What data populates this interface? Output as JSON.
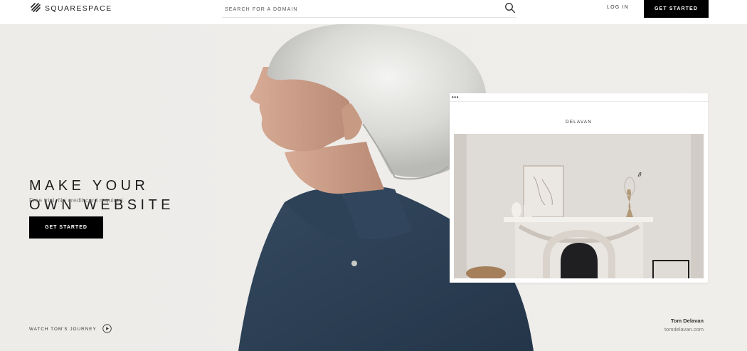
{
  "header": {
    "brand": "SQUARESPACE",
    "search_placeholder": "SEARCH FOR A DOMAIN",
    "login_label": "LOG IN",
    "cta_label": "GET STARTED"
  },
  "hero": {
    "headline_line1": "MAKE YOUR",
    "headline_line2": "OWN WEBSITE",
    "subtext": "Free trial. No credit card required.",
    "cta_label": "GET STARTED",
    "journey_label": "WATCH TOM'S JOURNEY"
  },
  "preview": {
    "dots": "•••",
    "site_name": "DELAVAN"
  },
  "credit": {
    "name": "Tom Delavan",
    "link": "tomdelavan.com"
  },
  "icons": {
    "logo": "squarespace-logo-icon",
    "search": "search-icon",
    "play": "play-circle-icon"
  }
}
